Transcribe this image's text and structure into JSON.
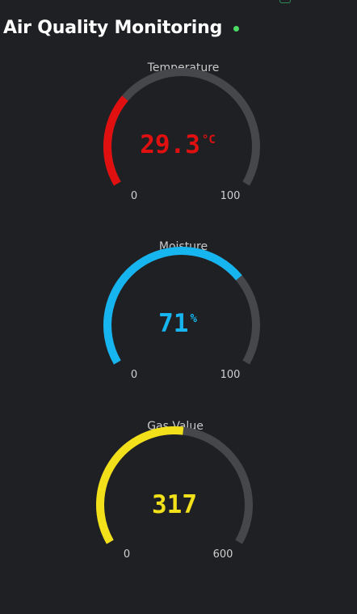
{
  "header": {
    "title": "Air Quality Monitoring",
    "status_color": "#4cd964"
  },
  "gauges": [
    {
      "label": "Temperature",
      "value": "29.3",
      "unit": "°C",
      "min": "0",
      "max": "100",
      "fraction": 0.293,
      "color": "#e01010"
    },
    {
      "label": "Moisture",
      "value": "71",
      "unit": "%",
      "min": "0",
      "max": "100",
      "fraction": 0.71,
      "color": "#16b5f0"
    },
    {
      "label": "Gas Value",
      "value": "317",
      "unit": "",
      "min": "0",
      "max": "600",
      "fraction": 0.528,
      "color": "#f2e01a"
    }
  ],
  "track_color": "#45474b"
}
